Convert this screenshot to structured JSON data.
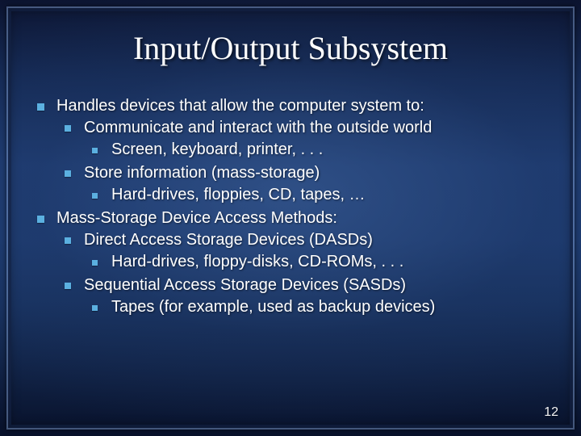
{
  "slide": {
    "title": "Input/Output Subsystem",
    "page_number": "12",
    "colors": {
      "bullet": "#5bb0e0",
      "bg_gradient_top": "#0c1430",
      "bg_gradient_mid": "#1f3d74"
    }
  },
  "bullets": [
    {
      "text": "Handles devices that allow the computer system to:",
      "children": [
        {
          "text": "Communicate and interact with the outside world",
          "children": [
            {
              "text": "Screen, keyboard, printer, . . ."
            }
          ]
        },
        {
          "text": "Store information (mass-storage)",
          "children": [
            {
              "text": "Hard-drives, floppies, CD, tapes, …"
            }
          ]
        }
      ]
    },
    {
      "text": "Mass-Storage Device Access Methods:",
      "children": [
        {
          "text": "Direct Access Storage Devices (DASDs)",
          "children": [
            {
              "text": "Hard-drives, floppy-disks, CD-ROMs, . . ."
            }
          ]
        },
        {
          "text": "Sequential Access Storage Devices (SASDs)",
          "children": [
            {
              "text": "Tapes (for example, used as backup devices)"
            }
          ]
        }
      ]
    }
  ]
}
